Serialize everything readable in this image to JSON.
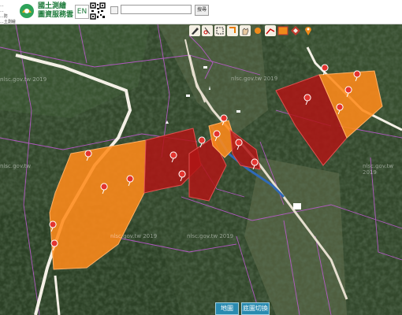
{
  "header": {
    "org_lines": [
      "...",
      "...",
      "...防",
      "...土測繪中心"
    ],
    "logo_title": "國土測繪",
    "logo_subtitle": "圖資服務雲",
    "lang_button": "EN",
    "search": {
      "placeholder": "",
      "button_label": "搜尋"
    }
  },
  "map": {
    "watermarks": [
      "nlsc.gov.tw 2019",
      "nlsc.gov.tw",
      "nlsc.gov.tw 2019",
      "nlsc.gov.tw 2019",
      "nlsc.gov.tw 2019",
      "nlsc.gov.tw 2019"
    ],
    "toolbar_icons": [
      "pen-icon",
      "cut-icon",
      "select-icon",
      "edit-icon",
      "hand-icon",
      "point-icon",
      "line-icon",
      "rect-icon",
      "diamond-icon",
      "marker-icon"
    ]
  },
  "bottom_bar": {
    "map_button": "地圖",
    "basemap_button": "底圖切換"
  },
  "colors": {
    "orange_parcel": "#ff8a1a",
    "red_parcel": "#b01515",
    "pin_red": "#e3342f",
    "accent_green": "#1d7a3a",
    "button_blue": "#2a8bb0"
  }
}
